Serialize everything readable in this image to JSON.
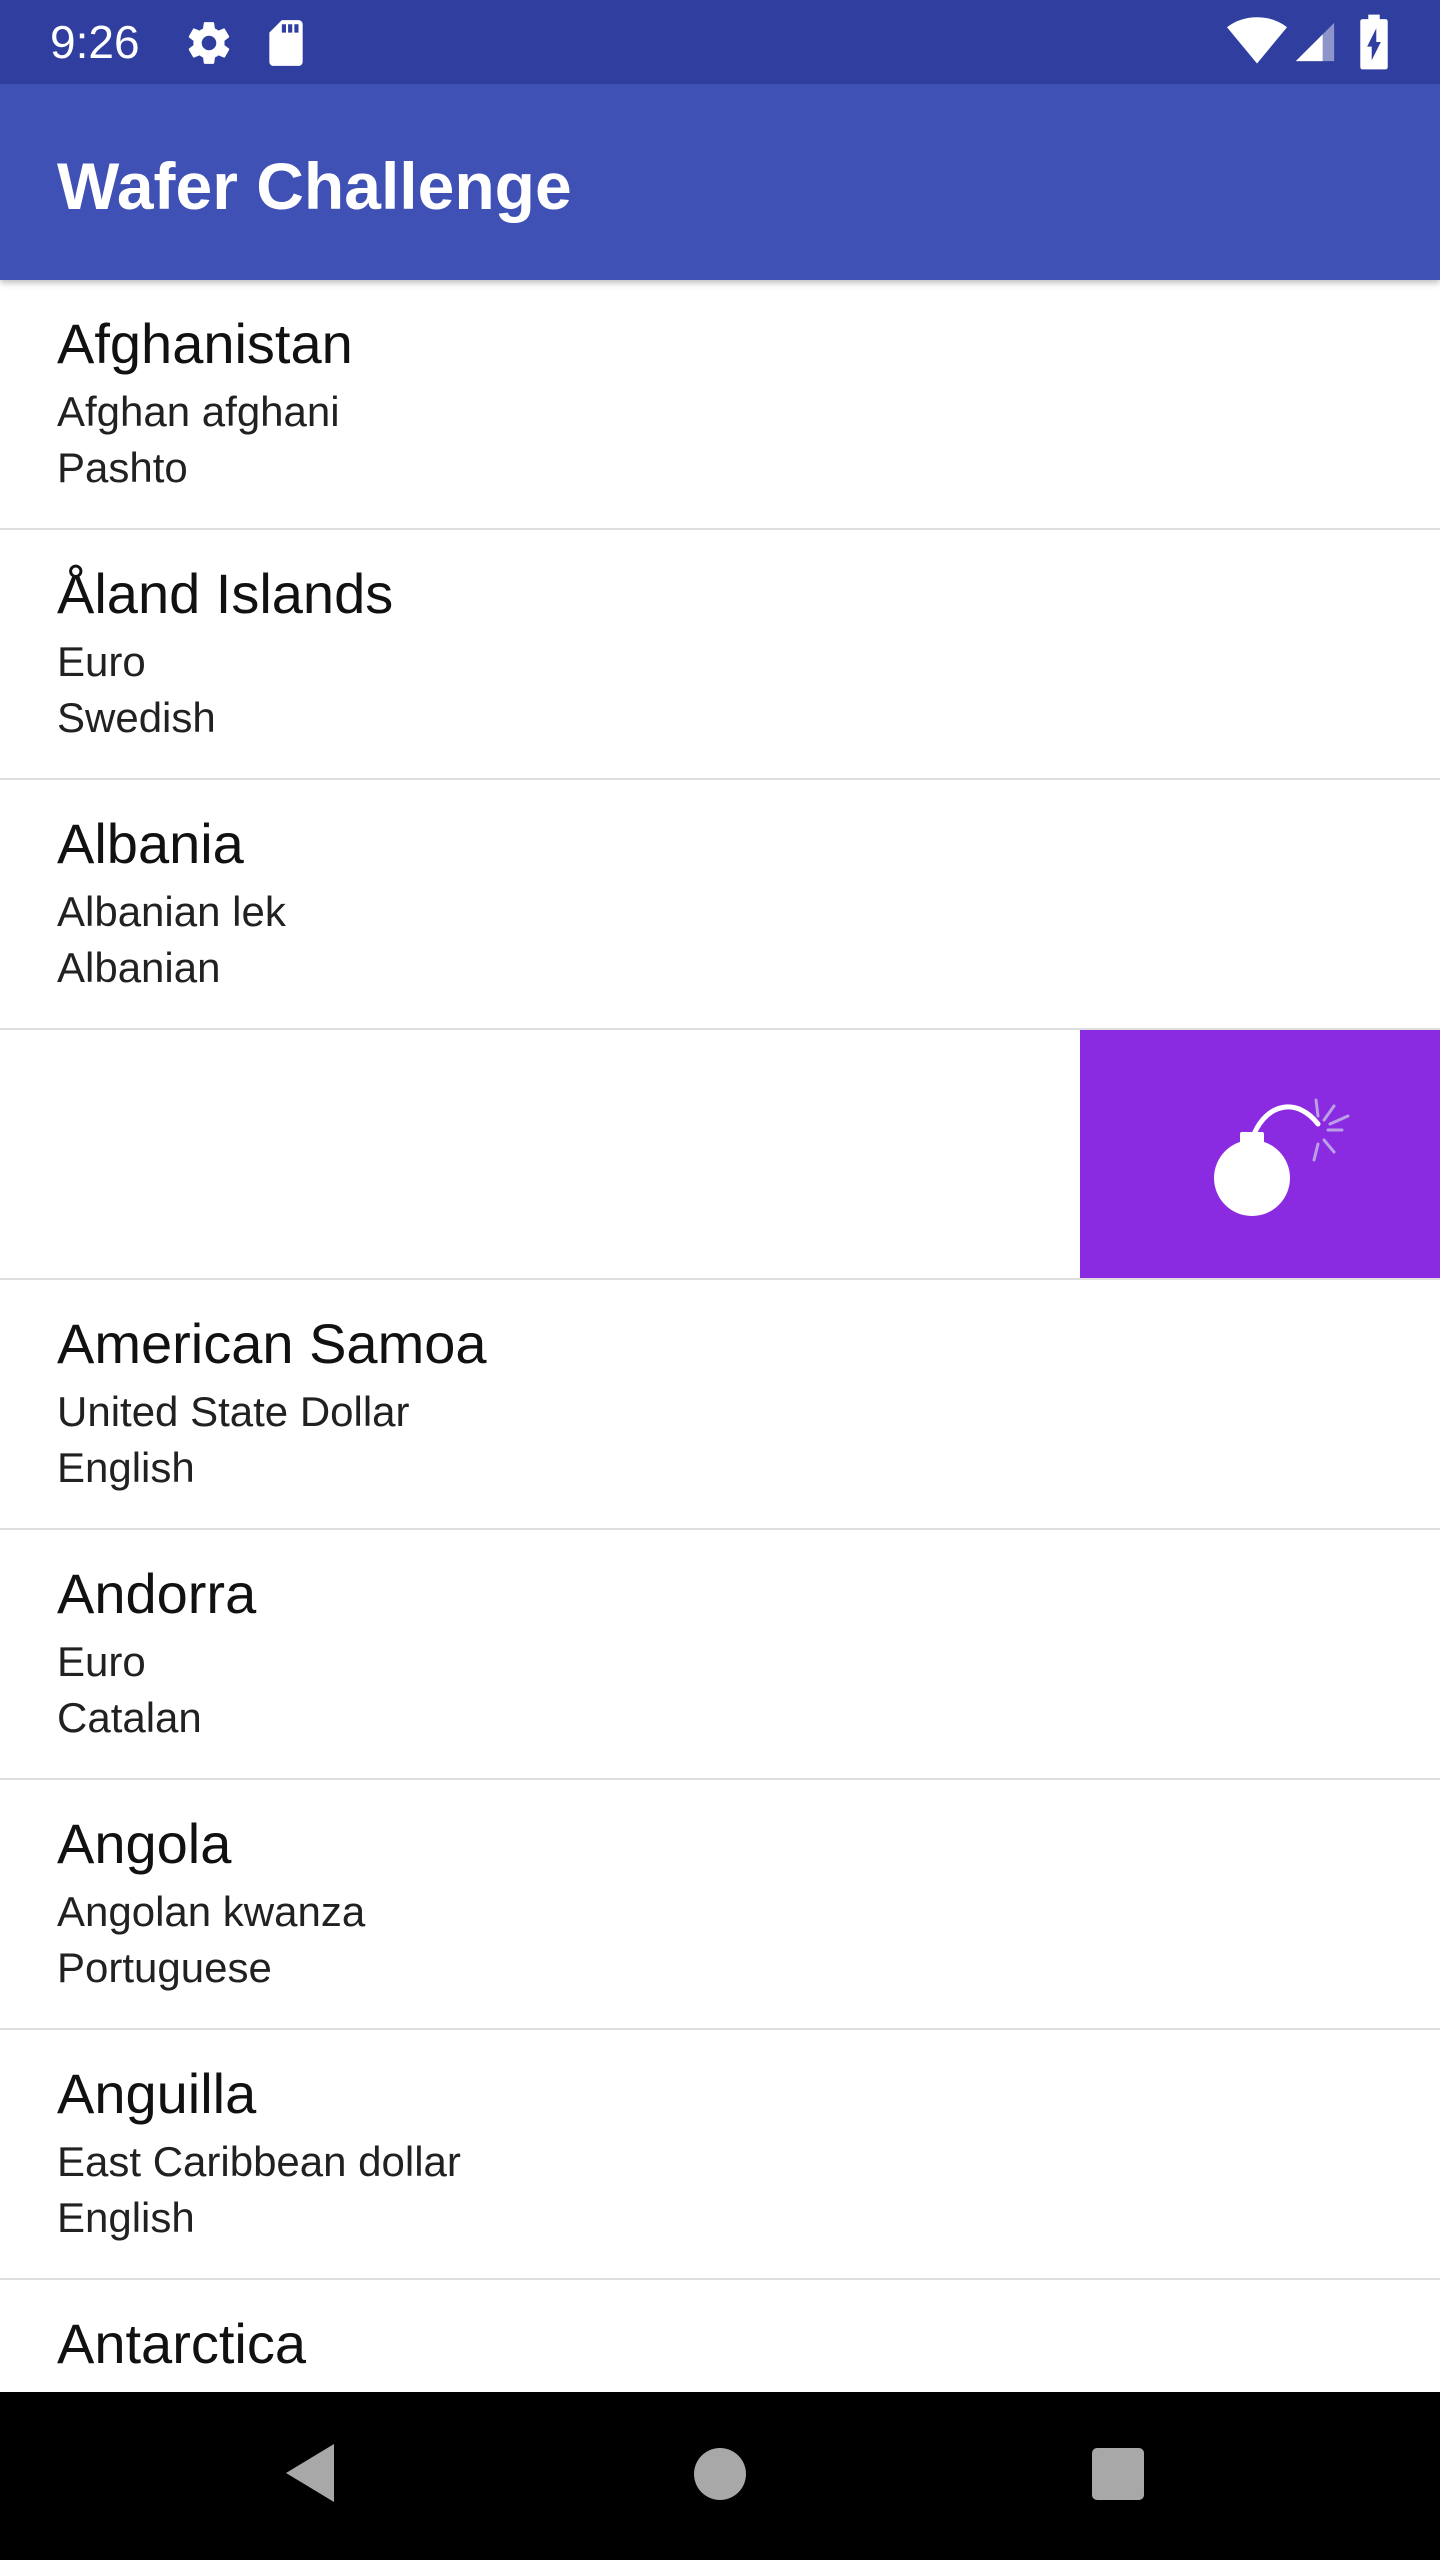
{
  "status_bar": {
    "time": "9:26",
    "icons": [
      "gear-icon",
      "sd-card-icon",
      "wifi-icon",
      "cell-signal-icon",
      "battery-charging-icon"
    ]
  },
  "app_bar": {
    "title": "Wafer Challenge"
  },
  "countries": [
    {
      "name": "Afghanistan",
      "currency": "Afghan afghani",
      "language": "Pashto"
    },
    {
      "name": "Åland Islands",
      "currency": "Euro",
      "language": "Swedish"
    },
    {
      "name": "Albania",
      "currency": "Albanian lek",
      "language": "Albanian"
    },
    {
      "name": "",
      "currency": "",
      "language": "",
      "swiped": true,
      "action_icon": "bomb-icon"
    },
    {
      "name": "American Samoa",
      "currency": "United State Dollar",
      "language": "English"
    },
    {
      "name": "Andorra",
      "currency": "Euro",
      "language": "Catalan"
    },
    {
      "name": "Angola",
      "currency": "Angolan kwanza",
      "language": "Portuguese"
    },
    {
      "name": "Anguilla",
      "currency": "East Caribbean dollar",
      "language": "English"
    },
    {
      "name": "Antarctica",
      "currency": "",
      "language": ""
    }
  ],
  "nav_bar": {
    "buttons": [
      "back-icon",
      "home-icon",
      "recents-icon"
    ]
  },
  "colors": {
    "status_bar": "#303f9f",
    "app_bar": "#3f51b5",
    "swipe_action": "#8a2be2"
  }
}
